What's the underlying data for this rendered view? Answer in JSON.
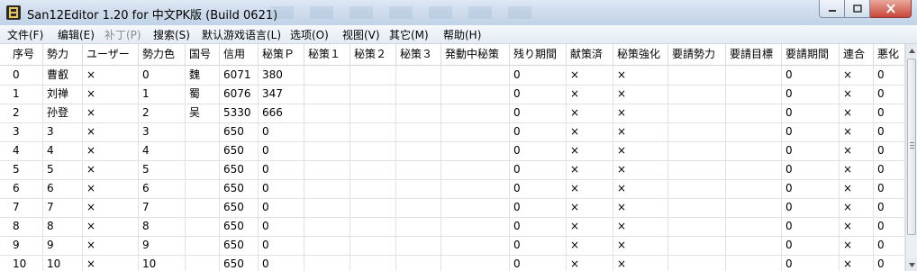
{
  "window": {
    "title": "San12Editor 1.20 for 中文PK版 (Build 0621)",
    "icon": "app-icon"
  },
  "menu": [
    {
      "label": "文件(F)",
      "disabled": false
    },
    {
      "label": "编辑(E)",
      "disabled": false
    },
    {
      "label": "补丁(P)",
      "disabled": true
    },
    {
      "label": "搜索(S)",
      "disabled": false
    },
    {
      "label": "默认游戏语言(L)",
      "disabled": false
    },
    {
      "label": "选项(O)",
      "disabled": false
    },
    {
      "label": "视图(V)",
      "disabled": false
    },
    {
      "label": "其它(M)",
      "disabled": false
    },
    {
      "label": "帮助(H)",
      "disabled": false
    }
  ],
  "table": {
    "columns": [
      "序号",
      "勢力",
      "ユーザー",
      "勢力色",
      "国号",
      "信用",
      "秘策Ｐ",
      "秘策１",
      "秘策２",
      "秘策３",
      "発動中秘策",
      "残り期間",
      "献策済",
      "秘策強化",
      "要請勢力",
      "要請目標",
      "要請期間",
      "連合",
      "悪化"
    ],
    "rows": [
      [
        "0",
        "曹叡",
        "×",
        "0",
        "魏",
        "6071",
        "380",
        "",
        "",
        "",
        "",
        "0",
        "×",
        "×",
        "",
        "",
        "0",
        "×",
        "0"
      ],
      [
        "1",
        "刘禅",
        "×",
        "1",
        "蜀",
        "6076",
        "347",
        "",
        "",
        "",
        "",
        "0",
        "×",
        "×",
        "",
        "",
        "0",
        "×",
        "0"
      ],
      [
        "2",
        "孙登",
        "×",
        "2",
        "吴",
        "5330",
        "666",
        "",
        "",
        "",
        "",
        "0",
        "×",
        "×",
        "",
        "",
        "0",
        "×",
        "0"
      ],
      [
        "3",
        "3",
        "×",
        "3",
        "",
        "650",
        "0",
        "",
        "",
        "",
        "",
        "0",
        "×",
        "×",
        "",
        "",
        "0",
        "×",
        "0"
      ],
      [
        "4",
        "4",
        "×",
        "4",
        "",
        "650",
        "0",
        "",
        "",
        "",
        "",
        "0",
        "×",
        "×",
        "",
        "",
        "0",
        "×",
        "0"
      ],
      [
        "5",
        "5",
        "×",
        "5",
        "",
        "650",
        "0",
        "",
        "",
        "",
        "",
        "0",
        "×",
        "×",
        "",
        "",
        "0",
        "×",
        "0"
      ],
      [
        "6",
        "6",
        "×",
        "6",
        "",
        "650",
        "0",
        "",
        "",
        "",
        "",
        "0",
        "×",
        "×",
        "",
        "",
        "0",
        "×",
        "0"
      ],
      [
        "7",
        "7",
        "×",
        "7",
        "",
        "650",
        "0",
        "",
        "",
        "",
        "",
        "0",
        "×",
        "×",
        "",
        "",
        "0",
        "×",
        "0"
      ],
      [
        "8",
        "8",
        "×",
        "8",
        "",
        "650",
        "0",
        "",
        "",
        "",
        "",
        "0",
        "×",
        "×",
        "",
        "",
        "0",
        "×",
        "0"
      ],
      [
        "9",
        "9",
        "×",
        "9",
        "",
        "650",
        "0",
        "",
        "",
        "",
        "",
        "0",
        "×",
        "×",
        "",
        "",
        "0",
        "×",
        "0"
      ],
      [
        "10",
        "10",
        "×",
        "10",
        "",
        "650",
        "0",
        "",
        "",
        "",
        "",
        "0",
        "×",
        "×",
        "",
        "",
        "0",
        "×",
        "0"
      ]
    ]
  },
  "scrollbar": {
    "up_icon": "scroll-up-arrow-icon",
    "down_icon": "scroll-down-arrow-icon",
    "grip_icon": "grip-icon"
  },
  "colors": {
    "titlebar": "#c9d8ec",
    "close_button": "#c7463a",
    "grid_line": "#e2e2e2"
  }
}
